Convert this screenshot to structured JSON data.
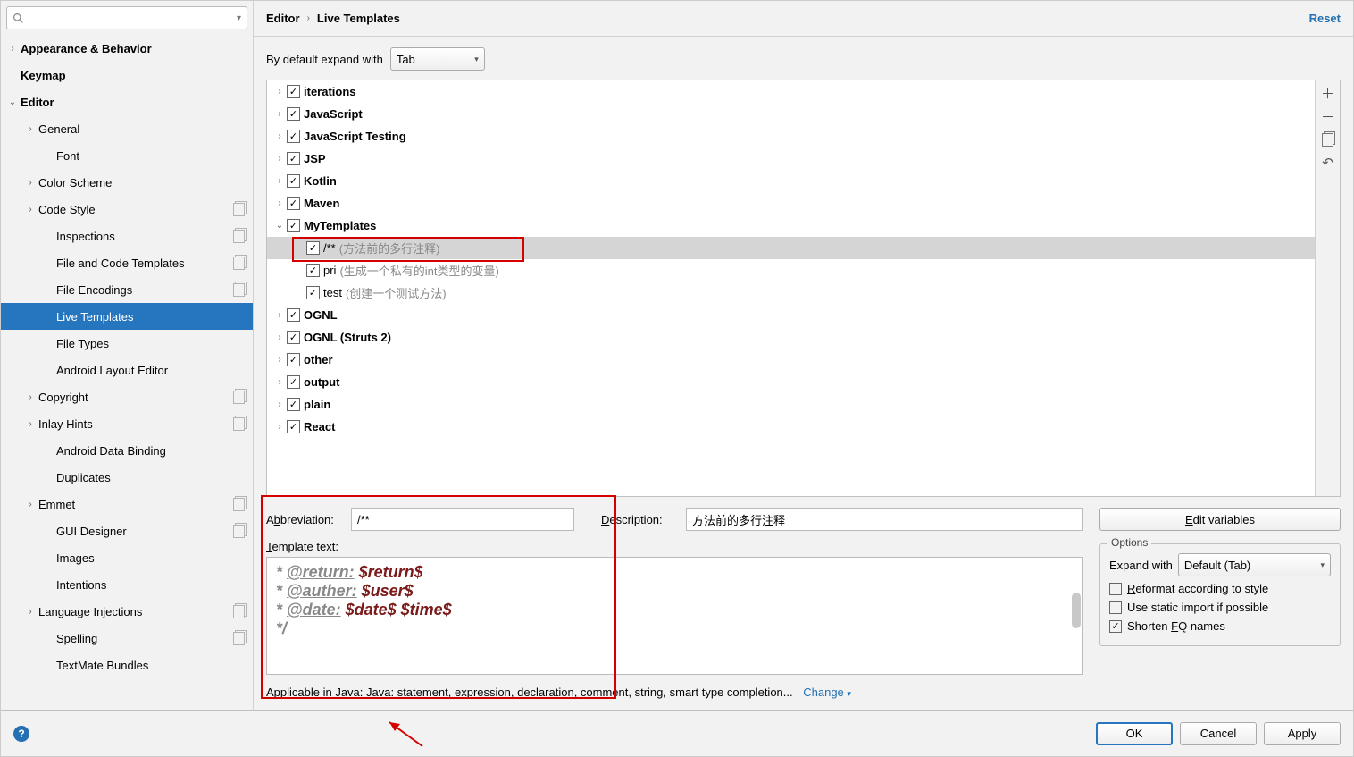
{
  "breadcrumb": {
    "a": "Editor",
    "b": "Live Templates"
  },
  "reset_label": "Reset",
  "search_placeholder": "",
  "sidebar": {
    "items": [
      {
        "label": "Appearance & Behavior",
        "indent": 0,
        "arrow": "›",
        "bold": true,
        "endicon": false
      },
      {
        "label": "Keymap",
        "indent": 0,
        "arrow": "",
        "bold": true,
        "endicon": false
      },
      {
        "label": "Editor",
        "indent": 0,
        "arrow": "⌄",
        "bold": true,
        "endicon": false
      },
      {
        "label": "General",
        "indent": 1,
        "arrow": "›",
        "bold": false,
        "endicon": false
      },
      {
        "label": "Font",
        "indent": 2,
        "arrow": "",
        "bold": false,
        "endicon": false
      },
      {
        "label": "Color Scheme",
        "indent": 1,
        "arrow": "›",
        "bold": false,
        "endicon": false
      },
      {
        "label": "Code Style",
        "indent": 1,
        "arrow": "›",
        "bold": false,
        "endicon": true
      },
      {
        "label": "Inspections",
        "indent": 2,
        "arrow": "",
        "bold": false,
        "endicon": true
      },
      {
        "label": "File and Code Templates",
        "indent": 2,
        "arrow": "",
        "bold": false,
        "endicon": true
      },
      {
        "label": "File Encodings",
        "indent": 2,
        "arrow": "",
        "bold": false,
        "endicon": true
      },
      {
        "label": "Live Templates",
        "indent": 2,
        "arrow": "",
        "bold": false,
        "endicon": false,
        "selected": true
      },
      {
        "label": "File Types",
        "indent": 2,
        "arrow": "",
        "bold": false,
        "endicon": false
      },
      {
        "label": "Android Layout Editor",
        "indent": 2,
        "arrow": "",
        "bold": false,
        "endicon": false
      },
      {
        "label": "Copyright",
        "indent": 1,
        "arrow": "›",
        "bold": false,
        "endicon": true
      },
      {
        "label": "Inlay Hints",
        "indent": 1,
        "arrow": "›",
        "bold": false,
        "endicon": true
      },
      {
        "label": "Android Data Binding",
        "indent": 2,
        "arrow": "",
        "bold": false,
        "endicon": false
      },
      {
        "label": "Duplicates",
        "indent": 2,
        "arrow": "",
        "bold": false,
        "endicon": false
      },
      {
        "label": "Emmet",
        "indent": 1,
        "arrow": "›",
        "bold": false,
        "endicon": true
      },
      {
        "label": "GUI Designer",
        "indent": 2,
        "arrow": "",
        "bold": false,
        "endicon": true
      },
      {
        "label": "Images",
        "indent": 2,
        "arrow": "",
        "bold": false,
        "endicon": false
      },
      {
        "label": "Intentions",
        "indent": 2,
        "arrow": "",
        "bold": false,
        "endicon": false
      },
      {
        "label": "Language Injections",
        "indent": 1,
        "arrow": "›",
        "bold": false,
        "endicon": true
      },
      {
        "label": "Spelling",
        "indent": 2,
        "arrow": "",
        "bold": false,
        "endicon": true
      },
      {
        "label": "TextMate Bundles",
        "indent": 2,
        "arrow": "",
        "bold": false,
        "endicon": false
      }
    ]
  },
  "expand_label": "By default expand with",
  "expand_value": "Tab",
  "tree": [
    {
      "label": "iterations",
      "arrow": "›",
      "indent": 0
    },
    {
      "label": "JavaScript",
      "arrow": "›",
      "indent": 0
    },
    {
      "label": "JavaScript Testing",
      "arrow": "›",
      "indent": 0
    },
    {
      "label": "JSP",
      "arrow": "›",
      "indent": 0
    },
    {
      "label": "Kotlin",
      "arrow": "›",
      "indent": 0
    },
    {
      "label": "Maven",
      "arrow": "›",
      "indent": 0
    },
    {
      "label": "MyTemplates",
      "arrow": "⌄",
      "indent": 0
    },
    {
      "label": "/**",
      "desc": "(方法前的多行注释)",
      "arrow": "",
      "indent": 1,
      "leaf": true,
      "selected": true
    },
    {
      "label": "pri",
      "desc": "(生成一个私有的int类型的变量)",
      "arrow": "",
      "indent": 1,
      "leaf": true
    },
    {
      "label": "test",
      "desc": "(创建一个测试方法)",
      "arrow": "",
      "indent": 1,
      "leaf": true
    },
    {
      "label": "OGNL",
      "arrow": "›",
      "indent": 0
    },
    {
      "label": "OGNL (Struts 2)",
      "arrow": "›",
      "indent": 0
    },
    {
      "label": "other",
      "arrow": "›",
      "indent": 0
    },
    {
      "label": "output",
      "arrow": "›",
      "indent": 0
    },
    {
      "label": "plain",
      "arrow": "›",
      "indent": 0
    },
    {
      "label": "React",
      "arrow": "›",
      "indent": 0
    }
  ],
  "abbr_label": "Abbreviation:",
  "abbr_value": "/**",
  "desc_label": "Description:",
  "desc_value": "方法前的多行注释",
  "tmpl_label": "Template text:",
  "tmpl_lines": [
    [
      {
        "t": "* ",
        "cls": "c-star"
      },
      {
        "t": "@return:",
        "cls": "c-tag"
      },
      {
        "t": " ",
        "cls": ""
      },
      {
        "t": "$return$",
        "cls": "c-var"
      }
    ],
    [
      {
        "t": "* ",
        "cls": "c-star"
      },
      {
        "t": "@auther:",
        "cls": "c-tag"
      },
      {
        "t": " ",
        "cls": ""
      },
      {
        "t": "$user$",
        "cls": "c-var"
      }
    ],
    [
      {
        "t": "* ",
        "cls": "c-star"
      },
      {
        "t": "@date:",
        "cls": "c-tag"
      },
      {
        "t": " ",
        "cls": ""
      },
      {
        "t": "$date$ $time$",
        "cls": "c-var"
      }
    ],
    [
      {
        "t": "*/",
        "cls": "c-star"
      }
    ]
  ],
  "edit_vars": "Edit variables",
  "options_legend": "Options",
  "opt_expand": "Expand with",
  "opt_expand_val": "Default (Tab)",
  "opt_reformat": "Reformat according to style",
  "opt_static": "Use static import if possible",
  "opt_fq": "Shorten FQ names",
  "applicable_text": "Applicable in Java: Java: statement, expression, declaration, comment, string, smart type completion...",
  "change_label": "Change",
  "btn_ok": "OK",
  "btn_cancel": "Cancel",
  "btn_apply": "Apply"
}
